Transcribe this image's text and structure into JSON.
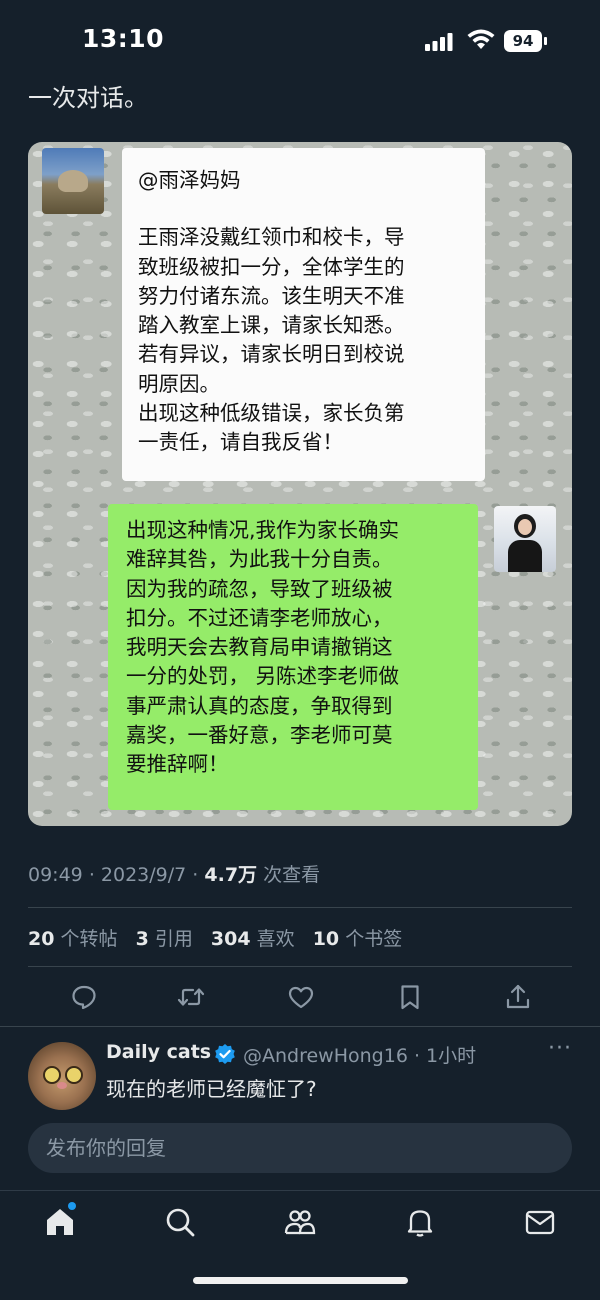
{
  "status_bar": {
    "time": "13:10",
    "battery": "94"
  },
  "tweet": {
    "text": "一次对话。",
    "image": {
      "teacher_message": {
        "mention": "@雨泽妈妈",
        "lines": [
          "王雨泽没戴红领巾和校卡，导",
          "致班级被扣一分，全体学生的",
          "努力付诸东流。该生明天不准",
          "踏入教室上课，请家长知悉。",
          "若有异议，请家长明日到校说",
          "明原因。",
          "出现这种低级错误，家长负第",
          "一责任，请自我反省！"
        ]
      },
      "parent_message": {
        "lines": [
          "出现这种情况,我作为家长确实",
          "难辞其咎，为此我十分自责。",
          "因为我的疏忽，导致了班级被",
          "扣分。不过还请李老师放心，",
          "我明天会去教育局申请撤销这",
          "一分的处罚， 另陈述李老师做",
          "事严肃认真的态度，争取得到",
          "嘉奖，一番好意，李老师可莫",
          "要推辞啊！"
        ]
      }
    },
    "meta": {
      "time": "09:49",
      "date": "2023/9/7",
      "views_count": "4.7万",
      "views_label": "次查看"
    },
    "stats": [
      {
        "count": "20",
        "label": "个转帖"
      },
      {
        "count": "3",
        "label": "引用"
      },
      {
        "count": "304",
        "label": "喜欢"
      },
      {
        "count": "10",
        "label": "个书签"
      }
    ]
  },
  "reply": {
    "name": "Daily cats",
    "handle_time": "@AndrewHong16 · 1小时",
    "text": "现在的老师已经魔怔了?"
  },
  "reply_input": {
    "placeholder": "发布你的回复"
  },
  "colors": {
    "background": "#15202b",
    "accent": "#1d9bf0",
    "wechat_green": "#95ec69",
    "muted_text": "#8b98a5"
  },
  "icons": {
    "actions": [
      "reply-icon",
      "retweet-icon",
      "like-icon",
      "bookmark-icon",
      "share-icon"
    ],
    "nav": [
      "home-icon",
      "search-icon",
      "communities-icon",
      "notifications-icon",
      "messages-icon"
    ]
  }
}
